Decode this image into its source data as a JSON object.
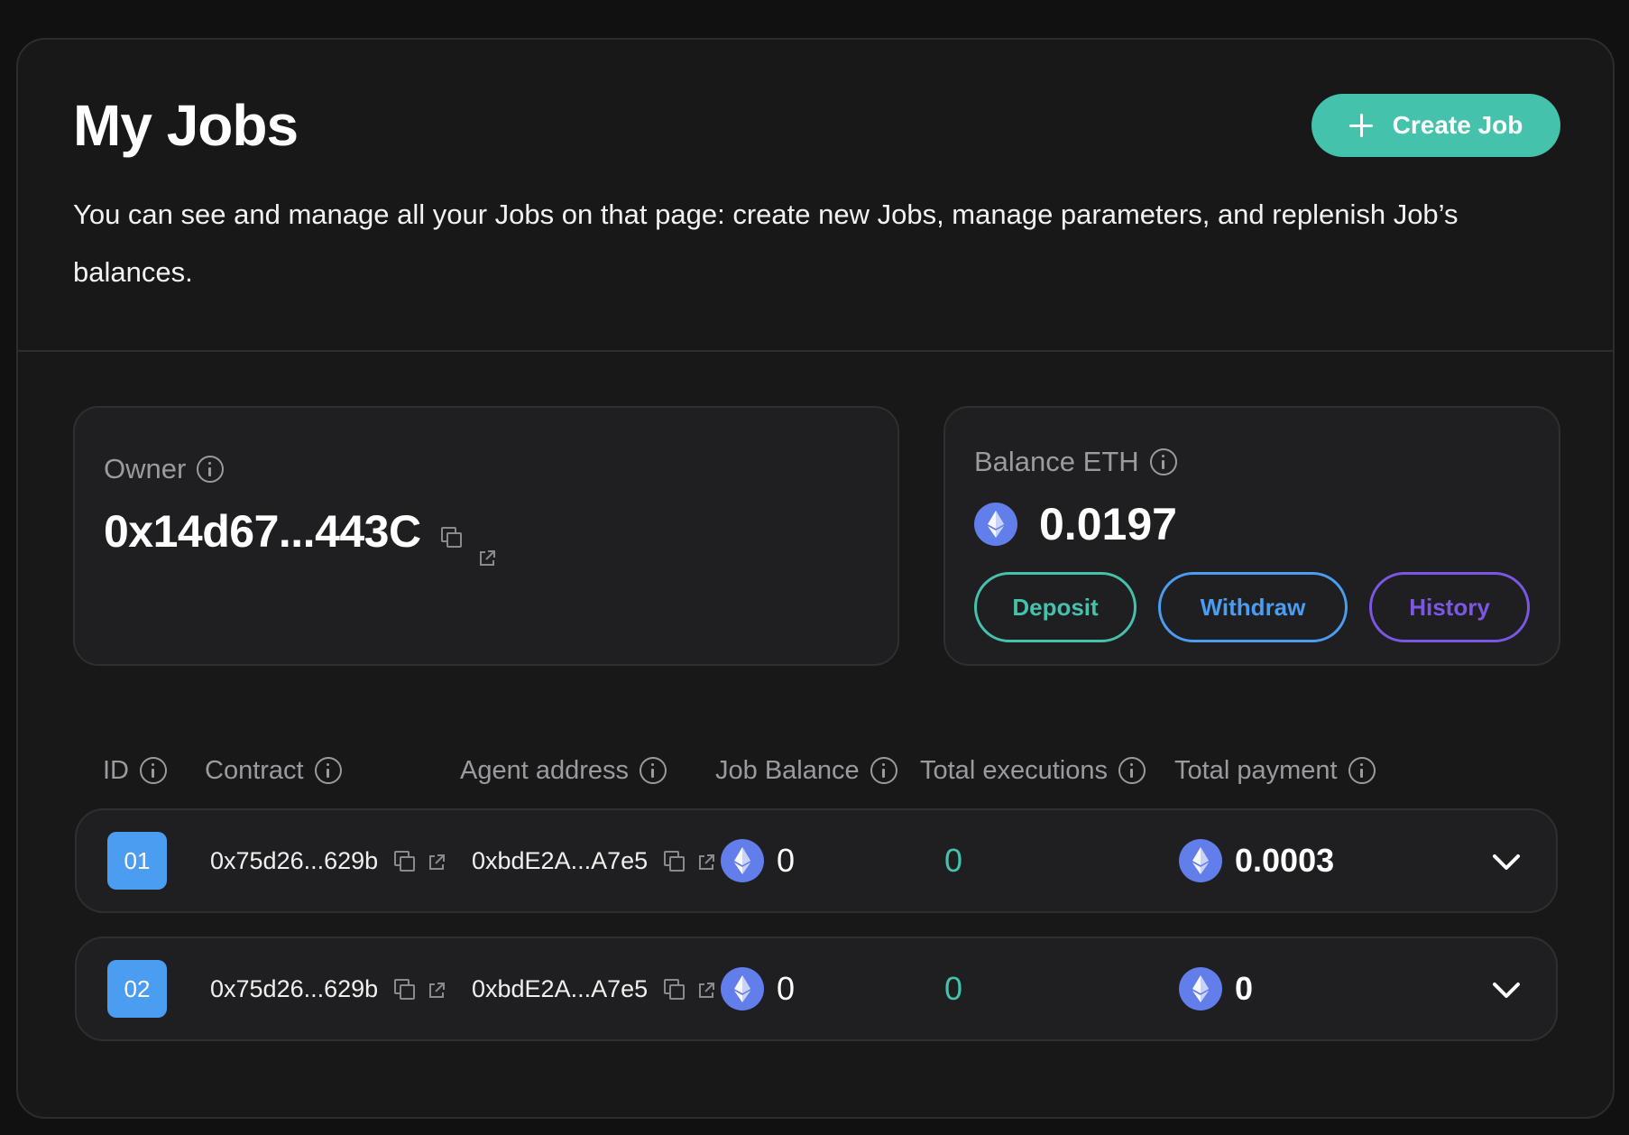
{
  "header": {
    "title": "My Jobs",
    "description": "You can see and manage all your Jobs on that page: create new Jobs, manage parameters, and replenish Job’s balances.",
    "create_button_label": "Create Job"
  },
  "owner": {
    "label": "Owner",
    "address": "0x14d67...443C"
  },
  "balance": {
    "label": "Balance ETH",
    "value": "0.0197",
    "deposit_label": "Deposit",
    "withdraw_label": "Withdraw",
    "history_label": "History"
  },
  "table": {
    "columns": [
      "ID",
      "Contract",
      "Agent address",
      "Job Balance",
      "Total executions",
      "Total payment"
    ],
    "rows": [
      {
        "id": "01",
        "contract": "0x75d26...629b",
        "agent": "0xbdE2A...A7e5",
        "job_balance": "0",
        "executions": "0",
        "payment": "0.0003"
      },
      {
        "id": "02",
        "contract": "0x75d26...629b",
        "agent": "0xbdE2A...A7e5",
        "job_balance": "0",
        "executions": "0",
        "payment": "0"
      }
    ]
  },
  "colors": {
    "accent_teal": "#44c2ab",
    "accent_blue": "#4a9df0",
    "accent_purple": "#7b57e3",
    "eth_blue": "#627eea"
  },
  "icons": [
    "plus-icon",
    "info-icon",
    "copy-icon",
    "external-link-icon",
    "eth-icon",
    "chevron-down-icon"
  ]
}
